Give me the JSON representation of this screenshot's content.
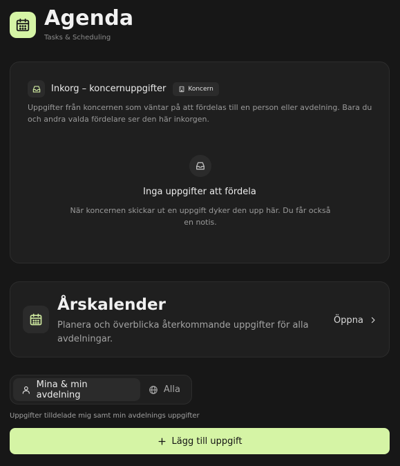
{
  "header": {
    "title": "Agenda",
    "subtitle": "Tasks & Scheduling",
    "logo_icon": "calendar-icon"
  },
  "inbox": {
    "icon": "inbox-icon",
    "title": "Inkorg – koncernuppgifter",
    "badge": "Koncern",
    "badge_icon": "building-icon",
    "description": "Uppgifter från koncernen som väntar på att fördelas till en person eller avdelning. Bara du och andra valda fördelare ser den här inkorgen.",
    "empty_title": "Inga uppgifter att fördela",
    "empty_description": "När koncernen skickar ut en uppgift dyker den upp här. Du får också en notis."
  },
  "calendar": {
    "icon": "calendar-icon",
    "title": "Årskalender",
    "description": "Planera och överblicka återkommande uppgifter för alla avdelningar.",
    "open_label": "Öppna"
  },
  "filter": {
    "options": [
      {
        "label": "Mina & min avdelning",
        "icon": "user-icon",
        "active": true
      },
      {
        "label": "Alla",
        "icon": "globe-icon",
        "active": false
      }
    ],
    "caption": "Uppgifter tilldelade mig samt min avdelnings uppgifter"
  },
  "actions": {
    "add_task_label": "Lägg till uppgift"
  },
  "colors": {
    "accent": "#d5f4a5",
    "background": "#171717",
    "card": "#1f1f1f"
  }
}
